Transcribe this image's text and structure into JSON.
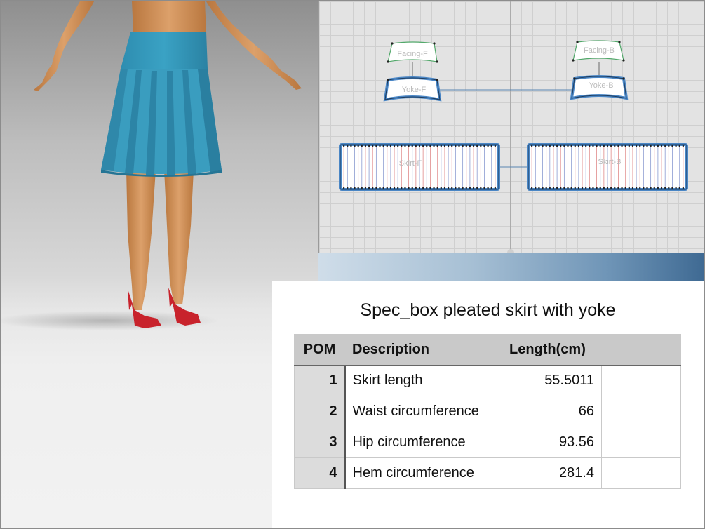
{
  "pattern": {
    "pieces": {
      "facing_front": "Facing-F",
      "facing_back": "Facing-B",
      "yoke_front": "Yoke-F",
      "yoke_back": "Yoke-B",
      "skirt_front": "Skirt-F",
      "skirt_back": "Skirt-B"
    }
  },
  "spec": {
    "title": "Spec_box pleated skirt with yoke",
    "headers": {
      "pom": "POM",
      "description": "Description",
      "length": "Length(cm)",
      "extra": ""
    },
    "rows": [
      {
        "pom": "1",
        "description": "Skirt length",
        "length": "55.5011"
      },
      {
        "pom": "2",
        "description": "Waist circumference",
        "length": "66"
      },
      {
        "pom": "3",
        "description": "Hip circumference",
        "length": "93.56"
      },
      {
        "pom": "4",
        "description": "Hem circumference",
        "length": "281.4"
      }
    ]
  },
  "colors": {
    "skirt": "#3a9dbf",
    "selection_outline": "#4a86c5",
    "shoe": "#c8232c",
    "skin": "#d4925f"
  }
}
